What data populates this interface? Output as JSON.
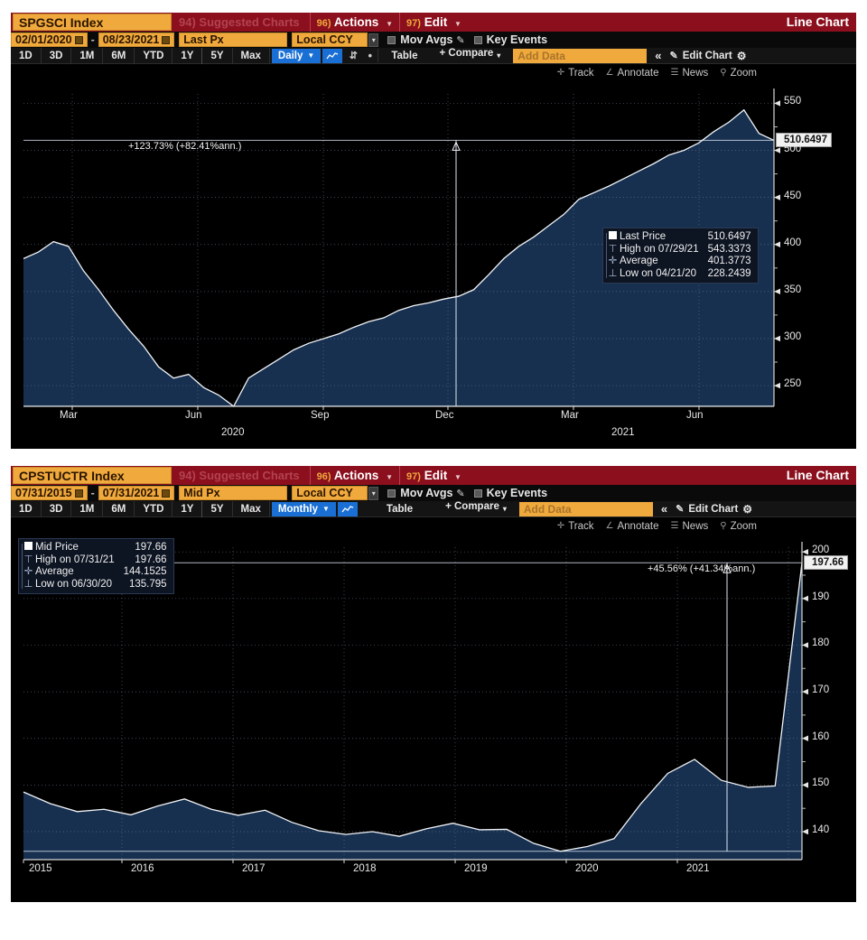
{
  "panels": [
    {
      "header": {
        "ticker": "SPGSCI Index",
        "suggested": "94) Suggested Charts",
        "actions_num": "96)",
        "actions": "Actions",
        "edit_num": "97)",
        "edit": "Edit",
        "chart_type": "Line Chart"
      },
      "row2": {
        "date_from": "02/01/2020",
        "date_to": "08/23/2021",
        "price_field": "Last Px",
        "currency": "Local CCY",
        "mov_avgs": "Mov Avgs",
        "key_events": "Key Events"
      },
      "periods": [
        "1D",
        "3D",
        "1M",
        "6M",
        "YTD",
        "1Y",
        "5Y",
        "Max"
      ],
      "frequency": "Daily",
      "table_label": "Table",
      "compare_label": "+ Compare",
      "add_data_placeholder": "Add Data",
      "edit_chart_label": "Edit Chart",
      "tools": [
        "Track",
        "Annotate",
        "News",
        "Zoom"
      ],
      "annotation": "+123.73% (+82.41%ann.)",
      "last_price_tag": "510.6497",
      "legend": [
        {
          "icon": "square",
          "label": "Last Price",
          "value": "510.6497"
        },
        {
          "icon": "high",
          "label": "High on 07/29/21",
          "value": "543.3373"
        },
        {
          "icon": "avg",
          "label": "Average",
          "value": "401.3773"
        },
        {
          "icon": "low",
          "label": "Low on 04/21/20",
          "value": "228.2439"
        }
      ],
      "chart_data": {
        "type": "area",
        "title": "SPGSCI Index",
        "xlabel": "",
        "ylabel": "",
        "ylim": [
          228,
          560
        ],
        "xlim": [
          "2020-02-01",
          "2021-08-23"
        ],
        "grid": true,
        "legend_position": "inside-right",
        "yticks": [
          250,
          300,
          350,
          400,
          450,
          500,
          550
        ],
        "xticks": [
          "Mar",
          "Jun",
          "Sep",
          "Dec",
          "Mar",
          "Jun"
        ],
        "xtick_years": [
          "2020",
          "2021"
        ],
        "series": [
          {
            "name": "Last Price",
            "x": [
              "2020-02-01",
              "2020-02-08",
              "2020-02-14",
              "2020-02-20",
              "2020-02-26",
              "2020-03-03",
              "2020-03-08",
              "2020-03-12",
              "2020-03-18",
              "2020-03-24",
              "2020-03-30",
              "2020-04-05",
              "2020-04-12",
              "2020-04-18",
              "2020-04-21",
              "2020-04-28",
              "2020-05-05",
              "2020-05-15",
              "2020-05-25",
              "2020-06-05",
              "2020-06-15",
              "2020-06-25",
              "2020-07-05",
              "2020-07-20",
              "2020-08-05",
              "2020-08-20",
              "2020-09-05",
              "2020-09-20",
              "2020-10-05",
              "2020-10-20",
              "2020-11-05",
              "2020-11-20",
              "2020-12-05",
              "2020-12-20",
              "2021-01-05",
              "2021-01-20",
              "2021-02-05",
              "2021-02-20",
              "2021-03-05",
              "2021-03-20",
              "2021-04-05",
              "2021-04-20",
              "2021-05-05",
              "2021-05-20",
              "2021-06-05",
              "2021-06-20",
              "2021-07-05",
              "2021-07-15",
              "2021-07-29",
              "2021-08-10",
              "2021-08-23"
            ],
            "values": [
              385,
              392,
              403,
              398,
              372,
              352,
              330,
              310,
              292,
              270,
              258,
              262,
              248,
              240,
              228,
              258,
              268,
              278,
              288,
              295,
              300,
              305,
              312,
              318,
              322,
              330,
              335,
              338,
              342,
              345,
              352,
              368,
              385,
              398,
              408,
              420,
              432,
              448,
              455,
              462,
              470,
              478,
              486,
              495,
              500,
              508,
              520,
              530,
              543,
              518,
              510.65
            ]
          }
        ],
        "reference_lines": [
          {
            "name": "low-line",
            "value": 228.2439
          },
          {
            "name": "annotation-line",
            "value": 510.6497
          }
        ],
        "annotations": [
          {
            "text": "+123.73% (+82.41%ann.)",
            "x": "2020-12-01"
          }
        ]
      }
    },
    {
      "header": {
        "ticker": "CPSTUCTR Index",
        "suggested": "94) Suggested Charts",
        "actions_num": "96)",
        "actions": "Actions",
        "edit_num": "97)",
        "edit": "Edit",
        "chart_type": "Line Chart"
      },
      "row2": {
        "date_from": "07/31/2015",
        "date_to": "07/31/2021",
        "price_field": "Mid Px",
        "currency": "Local CCY",
        "mov_avgs": "Mov Avgs",
        "key_events": "Key Events"
      },
      "periods": [
        "1D",
        "3D",
        "1M",
        "6M",
        "YTD",
        "1Y",
        "5Y",
        "Max"
      ],
      "frequency": "Monthly",
      "table_label": "Table",
      "compare_label": "+ Compare",
      "add_data_placeholder": "Add Data",
      "edit_chart_label": "Edit Chart",
      "tools": [
        "Track",
        "Annotate",
        "News",
        "Zoom"
      ],
      "annotation": "+45.56% (+41.34%ann.)",
      "last_price_tag": "197.66",
      "legend": [
        {
          "icon": "square",
          "label": "Mid Price",
          "value": "197.66"
        },
        {
          "icon": "high",
          "label": "High on 07/31/21",
          "value": "197.66"
        },
        {
          "icon": "avg",
          "label": "Average",
          "value": "144.1525"
        },
        {
          "icon": "low",
          "label": "Low on 06/30/20",
          "value": "135.795"
        }
      ],
      "chart_data": {
        "type": "area",
        "title": "CPSTUCTR Index",
        "xlabel": "",
        "ylabel": "",
        "ylim": [
          134,
          201
        ],
        "xlim": [
          "2015-07-31",
          "2021-07-31"
        ],
        "grid": true,
        "legend_position": "top-left",
        "yticks": [
          140,
          150,
          160,
          170,
          180,
          190,
          200
        ],
        "xticks": [
          "2015",
          "2016",
          "2017",
          "2018",
          "2019",
          "2020",
          "2021"
        ],
        "series": [
          {
            "name": "Mid Price",
            "x": [
              "2015-07",
              "2015-10",
              "2016-01",
              "2016-04",
              "2016-07",
              "2016-10",
              "2017-01",
              "2017-04",
              "2017-07",
              "2017-10",
              "2018-01",
              "2018-04",
              "2018-07",
              "2018-10",
              "2019-01",
              "2019-04",
              "2019-07",
              "2019-10",
              "2020-01",
              "2020-04",
              "2020-06",
              "2020-09",
              "2020-12",
              "2021-01",
              "2021-02",
              "2021-03",
              "2021-04",
              "2021-05",
              "2021-06",
              "2021-07"
            ],
            "values": [
              148.5,
              146.0,
              144.3,
              144.8,
              143.6,
              145.5,
              147.0,
              144.8,
              143.5,
              144.6,
              142.0,
              140.2,
              139.4,
              140.0,
              139.0,
              140.6,
              141.8,
              140.4,
              140.5,
              137.5,
              135.795,
              136.8,
              138.5,
              146.0,
              152.5,
              155.5,
              151.0,
              149.5,
              149.8,
              197.66
            ]
          }
        ],
        "reference_lines": [
          {
            "name": "low-line",
            "value": 135.795
          },
          {
            "name": "annotation-line",
            "value": 197.66
          }
        ],
        "annotations": [
          {
            "text": "+45.56% (+41.34%ann.)",
            "x": "2020-12-15"
          }
        ]
      }
    }
  ]
}
